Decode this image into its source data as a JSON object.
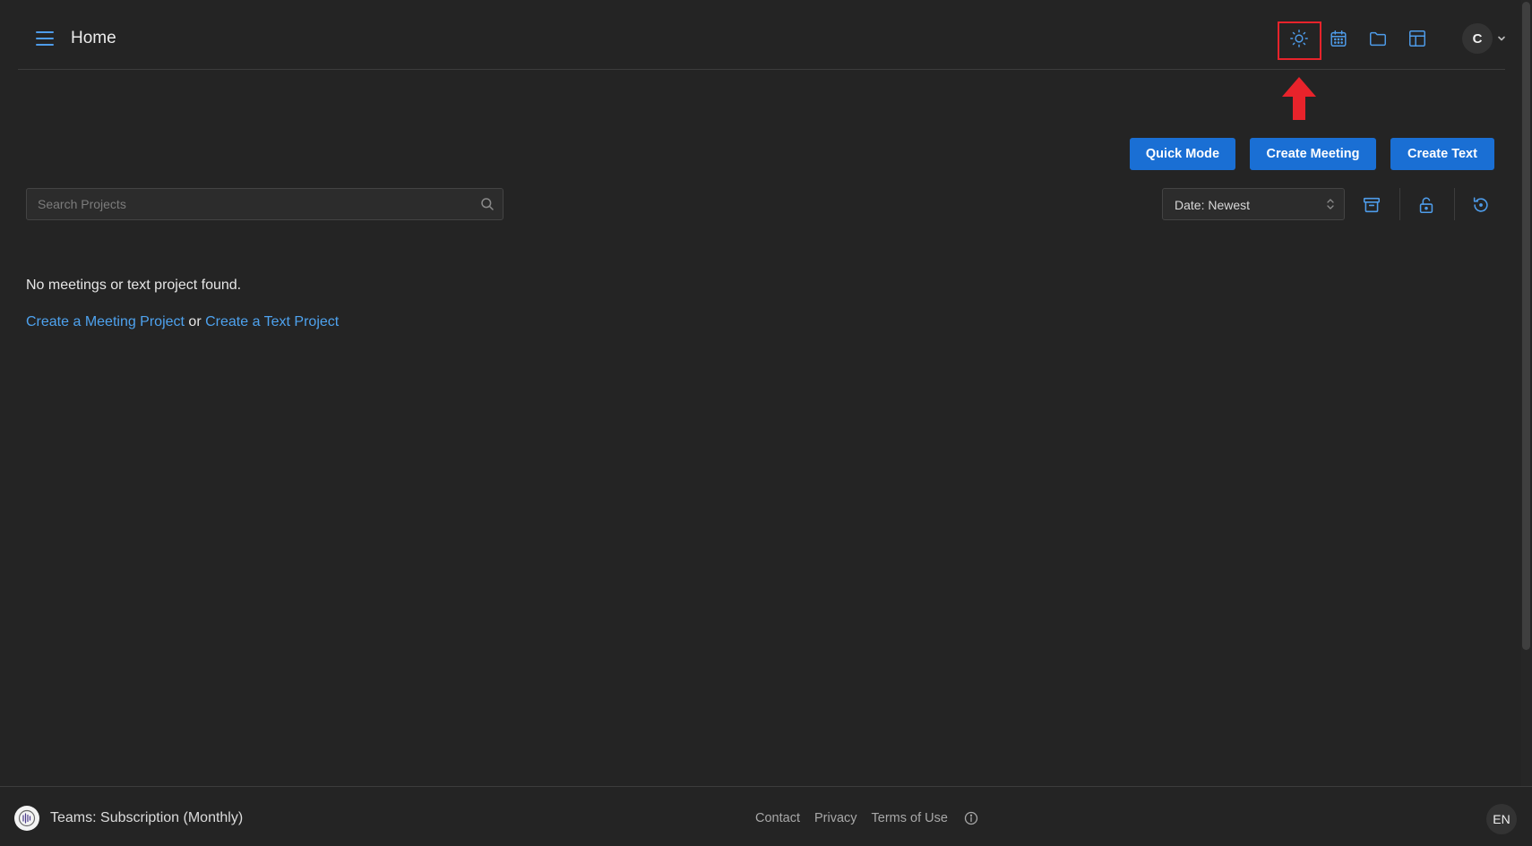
{
  "header": {
    "title": "Home",
    "icons": [
      "menu-icon",
      "sun-icon",
      "calendar-icon",
      "folder-icon",
      "table-icon",
      "chevron-down-icon"
    ],
    "avatar_initial": "C"
  },
  "actions": {
    "quick_mode": "Quick Mode",
    "create_meeting": "Create Meeting",
    "create_text": "Create Text"
  },
  "search": {
    "placeholder": "Search Projects",
    "value": ""
  },
  "sort": {
    "selected": "Date: Newest"
  },
  "toolbar_icons": [
    "archive-icon",
    "unlock-icon",
    "history-icon"
  ],
  "empty_state": {
    "message": "No meetings or text project found.",
    "link_meeting": "Create a Meeting Project",
    "connector": " or ",
    "link_text": "Create a Text Project"
  },
  "footer": {
    "plan": "Teams: Subscription (Monthly)",
    "links": {
      "contact": "Contact",
      "privacy": "Privacy",
      "terms": "Terms of Use"
    },
    "language": "EN"
  },
  "colors": {
    "background": "#242424",
    "primary_button": "#1a6fd4",
    "link": "#4ea2ee",
    "icon": "#4e9cea",
    "annotation_red": "#e8232b"
  }
}
